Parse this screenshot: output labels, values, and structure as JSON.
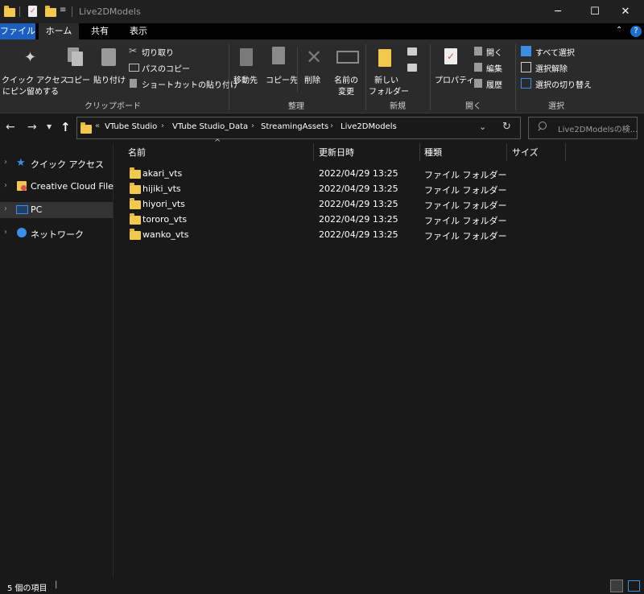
{
  "window": {
    "title": "Live2DModels",
    "controls": {
      "minimize": "─",
      "maximize": "☐",
      "close": "✕"
    }
  },
  "ribbon_tabs": [
    {
      "label": "ファイル"
    },
    {
      "label": "ホーム"
    },
    {
      "label": "共有"
    },
    {
      "label": "表示"
    }
  ],
  "ribbon": {
    "clipboard": {
      "pin_label_1": "クイック アクセス",
      "pin_label_2": "にピン留めする",
      "copy": "コピー",
      "paste": "貼り付け",
      "cut": "切り取り",
      "copy_path": "パスのコピー",
      "paste_shortcut": "ショートカットの貼り付け",
      "group": "クリップボード"
    },
    "organize": {
      "move_to": "移動先",
      "copy_to": "コピー先",
      "delete": "削除",
      "rename_1": "名前の",
      "rename_2": "変更",
      "group": "整理"
    },
    "new": {
      "new_folder_1": "新しい",
      "new_folder_2": "フォルダー",
      "group": "新規"
    },
    "open": {
      "properties": "プロパティ",
      "open": "開く",
      "edit": "編集",
      "history": "履歴",
      "group": "開く"
    },
    "select": {
      "select_all": "すべて選択",
      "select_none": "選択解除",
      "invert": "選択の切り替え",
      "group": "選択"
    }
  },
  "address": {
    "breadcrumbs": [
      "VTube Studio",
      "VTube Studio_Data",
      "StreamingAssets",
      "Live2DModels"
    ],
    "overflow": "«",
    "search_placeholder": "Live2DModelsの検..."
  },
  "nav_pane": [
    {
      "label": "クイック アクセス",
      "icon": "star-icon"
    },
    {
      "label": "Creative Cloud Files",
      "icon": "creative-cloud-icon"
    },
    {
      "label": "PC",
      "icon": "pc-icon",
      "selected": true
    },
    {
      "label": "ネットワーク",
      "icon": "network-icon"
    }
  ],
  "columns": [
    "名前",
    "更新日時",
    "種類",
    "サイズ"
  ],
  "files": [
    {
      "name": "akari_vts",
      "modified": "2022/04/29 13:25",
      "type": "ファイル フォルダー",
      "size": ""
    },
    {
      "name": "hijiki_vts",
      "modified": "2022/04/29 13:25",
      "type": "ファイル フォルダー",
      "size": ""
    },
    {
      "name": "hiyori_vts",
      "modified": "2022/04/29 13:25",
      "type": "ファイル フォルダー",
      "size": ""
    },
    {
      "name": "tororo_vts",
      "modified": "2022/04/29 13:25",
      "type": "ファイル フォルダー",
      "size": ""
    },
    {
      "name": "wanko_vts",
      "modified": "2022/04/29 13:25",
      "type": "ファイル フォルダー",
      "size": ""
    }
  ],
  "status": {
    "item_count": "5 個の項目",
    "separator": "|"
  },
  "colors": {
    "accent": "#1b5fc1",
    "folder": "#f2c94c",
    "background": "#191919"
  }
}
